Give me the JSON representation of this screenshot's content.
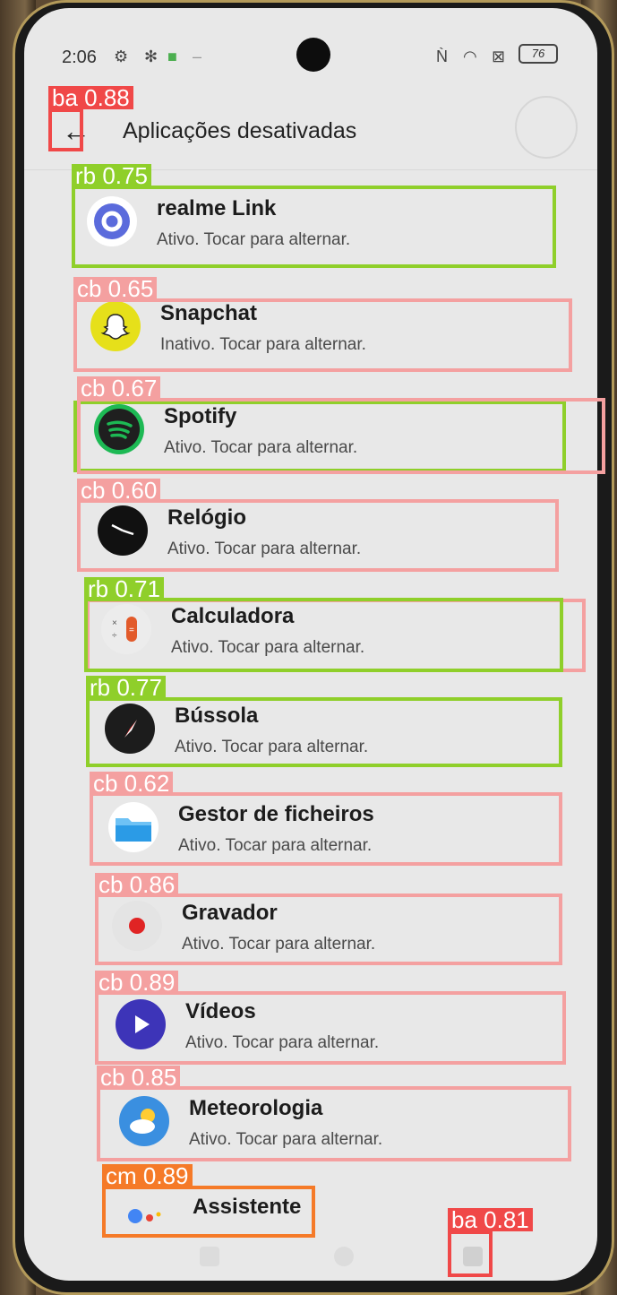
{
  "status_bar": {
    "time": "2:06",
    "battery": "76",
    "icons": [
      "settings-icon",
      "bug-icon",
      "android-icon",
      "dash-icon",
      "nfc-icon",
      "wifi-icon",
      "sim-off-icon",
      "battery-icon"
    ]
  },
  "app_bar": {
    "title": "Aplicações desativadas",
    "back_icon": "←"
  },
  "apps": [
    {
      "name": "realme Link",
      "status": "Ativo. Tocar para alternar.",
      "icon": "realme-link-icon",
      "color": "#5b6bdc"
    },
    {
      "name": "Snapchat",
      "status": "Inativo. Tocar para alternar.",
      "icon": "snapchat-icon",
      "color": "#e6e01a"
    },
    {
      "name": "Spotify",
      "status": "Ativo. Tocar para alternar.",
      "icon": "spotify-icon",
      "color": "#1f1f1f"
    },
    {
      "name": "Relógio",
      "status": "Ativo. Tocar para alternar.",
      "icon": "clock-icon",
      "color": "#111111"
    },
    {
      "name": "Calculadora",
      "status": "Ativo. Tocar para alternar.",
      "icon": "calculator-icon",
      "color": "#e25a2a"
    },
    {
      "name": "Bússola",
      "status": "Ativo. Tocar para alternar.",
      "icon": "compass-icon",
      "color": "#222222"
    },
    {
      "name": "Gestor de ficheiros",
      "status": "Ativo. Tocar para alternar.",
      "icon": "folder-icon",
      "color": "#2b9be6"
    },
    {
      "name": "Gravador",
      "status": "Ativo. Tocar para alternar.",
      "icon": "recorder-icon",
      "color": "#e02424"
    },
    {
      "name": "Vídeos",
      "status": "Ativo. Tocar para alternar.",
      "icon": "video-play-icon",
      "color": "#3d34b8"
    },
    {
      "name": "Meteorologia",
      "status": "Ativo. Tocar para alternar.",
      "icon": "weather-icon",
      "color": "#3a8fe0"
    },
    {
      "name": "Assistente",
      "status": "",
      "icon": "assistant-icon",
      "color": "#4285f4"
    }
  ],
  "detections": [
    {
      "label": "ba 0.88",
      "color": "red"
    },
    {
      "label": "rb 0.75",
      "color": "green"
    },
    {
      "label": "cb 0.65",
      "color": "pink"
    },
    {
      "label": "cb 0.67",
      "color": "pink"
    },
    {
      "label": "cb 0.60",
      "color": "pink"
    },
    {
      "label": "rb 0.71",
      "color": "green"
    },
    {
      "label": "rb 0.77",
      "color": "green"
    },
    {
      "label": "cb 0.62",
      "color": "pink"
    },
    {
      "label": "cb 0.86",
      "color": "pink"
    },
    {
      "label": "cb 0.89",
      "color": "pink"
    },
    {
      "label": "cb 0.85",
      "color": "pink"
    },
    {
      "label": "cm 0.89",
      "color": "orange"
    },
    {
      "label": "ba 0.81",
      "color": "red"
    }
  ]
}
